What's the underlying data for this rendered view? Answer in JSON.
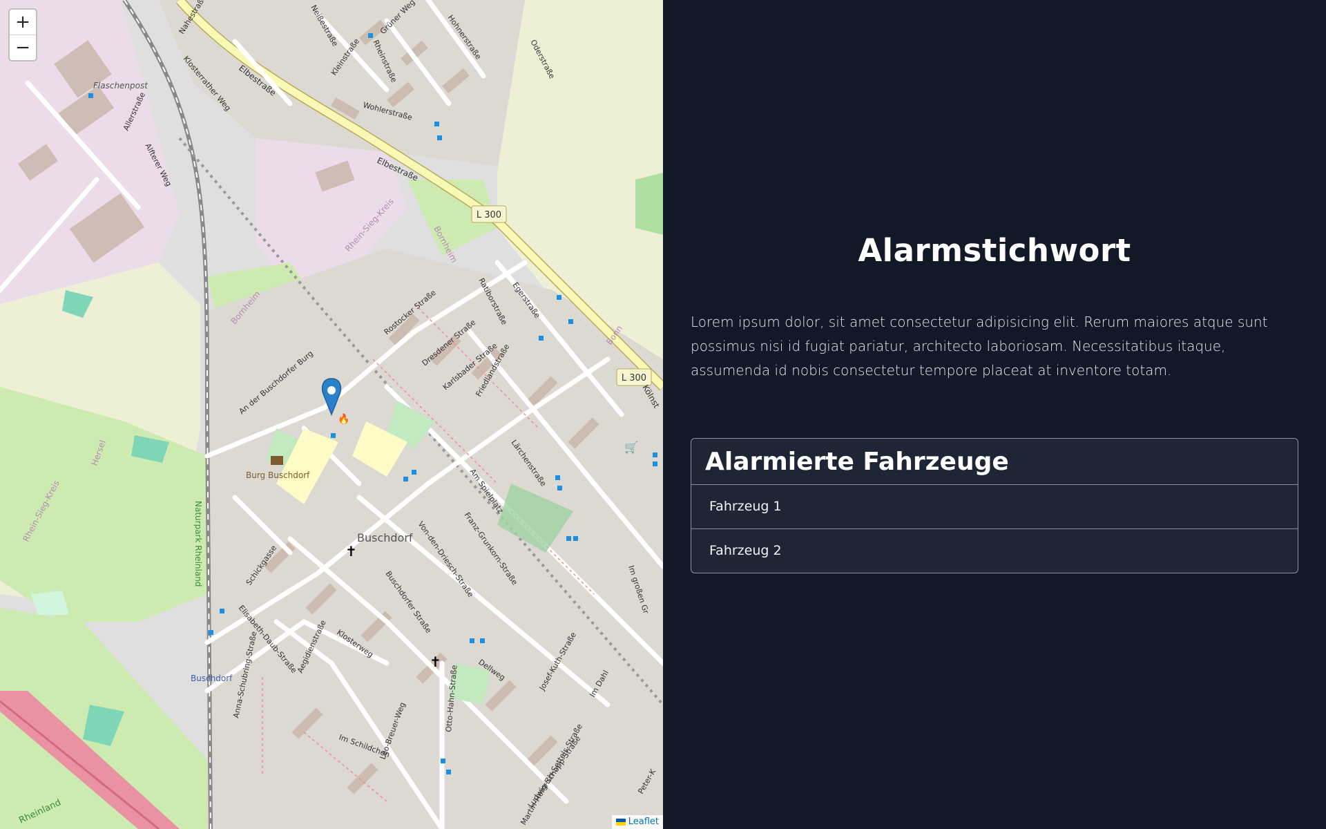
{
  "map": {
    "zoom_in_label": "+",
    "zoom_out_label": "−",
    "attribution": "Leaflet",
    "labels": {
      "flaschenpost": "Flaschenpost",
      "elbestrasse_1": "Elbestraße",
      "elbestrasse_2": "Elbestraße",
      "l300_1": "L 300",
      "l300_2": "L 300",
      "burg_buschdorf": "Burg Buschdorf",
      "buschdorf": "Buschdorf",
      "buschdorf_station": "Buschdorf",
      "naturpark": "Naturpark Rheinland",
      "rhein_sieg_kreis_1": "Rhein-Sieg-Kreis",
      "rhein_sieg_kreis_2": "Rhein-Sieg-Kreis",
      "bornheim_1": "Bornheim",
      "bornheim_2": "Bornheim",
      "bonn": "Bonn",
      "hersel": "Hersel",
      "rheinland": "Rheinland",
      "kolnstrasse": "Kölnst",
      "nahestrasse": "Nahestraße",
      "neissestrasse": "Neißestraße",
      "gruner_weg": "Grüner Weg",
      "hohnerstrasse": "Hohnerstraße",
      "oderstrasse": "Oderstraße",
      "kleinstrasse": "Kleinstraße",
      "rheinstrasse": "Rheinstraße",
      "wohlerstrasse": "Wohlerstraße",
      "klosterrather_weg": "Klosterrather Weg",
      "allerstrasse": "Allerstraße",
      "alfterer_weg": "Alfterer Weg",
      "rostocker_strasse": "Rostocker Straße",
      "dresdener_strasse": "Dresdener Straße",
      "karlsbader_strasse": "Karlsbader Straße",
      "ratiborstrasse": "Ratiborstraße",
      "egerstrasse": "Egerstraße",
      "friedlandstrasse": "Friedlandstraße",
      "an_der_buschdorfer_burg": "An der Buschdorfer Burg",
      "larchenstrasse": "Lärchenstraße",
      "am_spielplatz": "Am Spielplatz",
      "franz_grunkorn": "Franz-Grunkorn-Straße",
      "von_den_driesch": "Von-den-Driesch-Straße",
      "buschdorfer_strasse": "Buschdorfer Straße",
      "schickgasse": "Schickgasse",
      "elisabeth_daub": "Elisabeth-Daub-Straße",
      "aegidienstrasse": "Aegidienstraße",
      "klosterweg": "Klosterweg",
      "anna_schubring": "Anna-Schubring-Straße",
      "leo_breuer": "Leo-Breuer-Weg",
      "otto_hahn": "Otto-Hahn-Straße",
      "dellweg": "Dellweg",
      "josef_kuth": "Josef-Kuth-Straße",
      "im_dahl": "Im Dahl",
      "im_schildchen": "Im Schildchen",
      "ludwig_schopp": "Ludwig-Schopp-Straße",
      "martin_heinrich": "Martin-Heinrich-Settels-Straße",
      "im_grossen_gr": "Im großen Gr",
      "peter_k": "Peter-K"
    }
  },
  "info": {
    "title": "Alarmstichwort",
    "description": "Lorem ipsum dolor, sit amet consectetur adipisicing elit. Rerum maiores atque sunt possimus nisi id fugiat pariatur, architecto laboriosam. Necessitatibus itaque, assumenda id nobis consectetur tempore placeat at inventore totam.",
    "vehicles_header": "Alarmierte Fahrzeuge",
    "vehicles": [
      "Fahrzeug 1",
      "Fahrzeug 2"
    ]
  }
}
